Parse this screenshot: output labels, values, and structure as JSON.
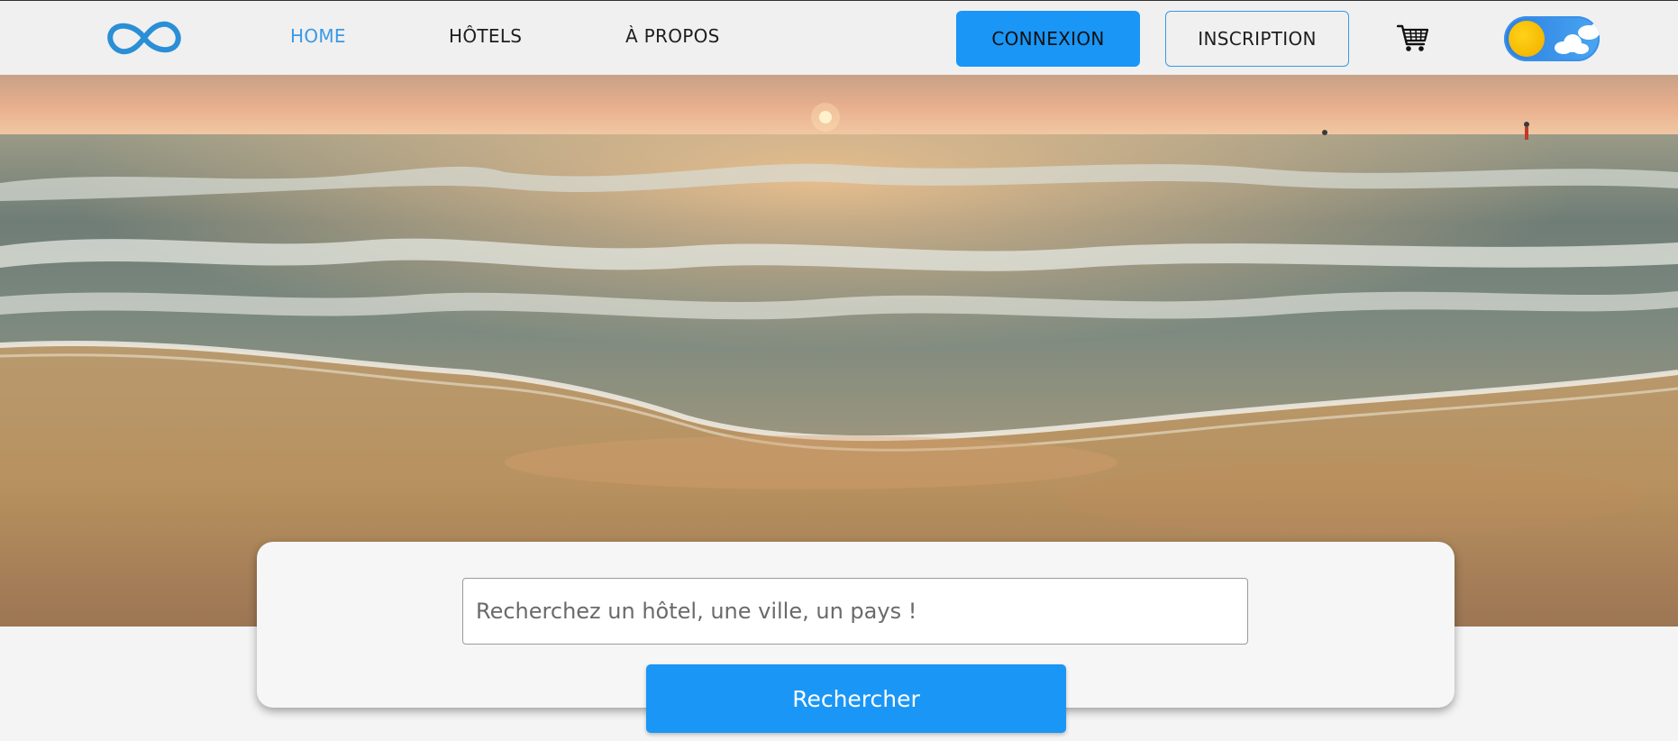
{
  "header": {
    "logo_icon": "infinity-icon",
    "nav": {
      "home": "HOME",
      "hotels": "HÔTELS",
      "about": "À PROPOS"
    },
    "login_label": "CONNEXION",
    "signup_label": "INSCRIPTION",
    "cart_icon": "shopping-cart-icon",
    "theme_toggle_icon": "sun-cloud-toggle-icon",
    "accent_color": "#1a96f6"
  },
  "hero": {
    "image": "beach-sunset-waves"
  },
  "search": {
    "placeholder": "Recherchez un hôtel, une ville, un pays !",
    "value": "",
    "button_label": "Rechercher"
  }
}
